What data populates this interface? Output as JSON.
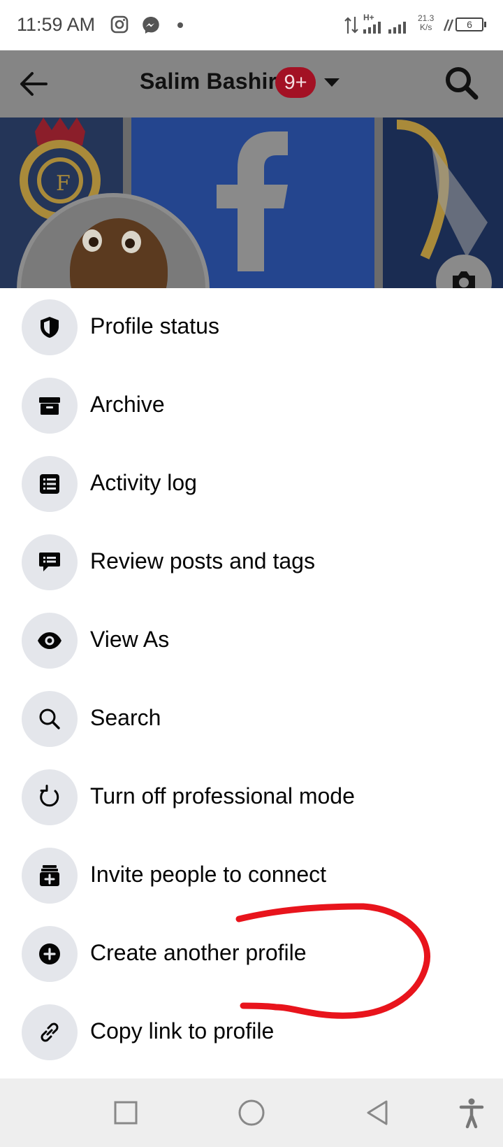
{
  "status_bar": {
    "time": "11:59 AM",
    "network_type": "H+",
    "net_speed_value": "21.3",
    "net_speed_unit": "K/s",
    "battery": "6",
    "icons": [
      "instagram-icon",
      "messenger-icon",
      "signal-icon",
      "charging-icon",
      "battery-icon"
    ]
  },
  "header": {
    "title": "Salim Bashir",
    "badge": "9+"
  },
  "menu": {
    "items": [
      {
        "label": "Profile status",
        "icon": "shield-icon"
      },
      {
        "label": "Archive",
        "icon": "archive-box-icon"
      },
      {
        "label": "Activity log",
        "icon": "list-icon"
      },
      {
        "label": "Review posts and tags",
        "icon": "comment-icon"
      },
      {
        "label": "View As",
        "icon": "eye-icon"
      },
      {
        "label": "Search",
        "icon": "search-icon"
      },
      {
        "label": "Turn off professional mode",
        "icon": "refresh-icon"
      },
      {
        "label": "Invite people to connect",
        "icon": "inbox-add-icon"
      },
      {
        "label": "Create another profile",
        "icon": "plus-circle-icon"
      },
      {
        "label": "Copy link to profile",
        "icon": "link-icon"
      }
    ]
  },
  "colors": {
    "header_dim": "#858585",
    "icon_bg": "#e4e6eb",
    "badge": "#a31124",
    "annotation": "#e8141c"
  }
}
